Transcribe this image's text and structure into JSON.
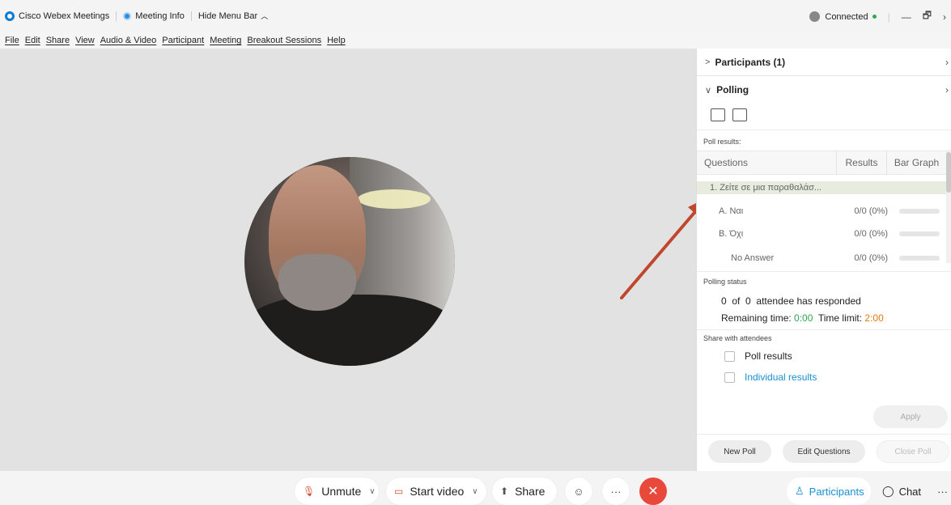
{
  "titlebar": {
    "app_name": "Cisco Webex Meetings",
    "meeting_info": "Meeting Info",
    "hide_menu": "Hide Menu Bar",
    "status": "Connected",
    "minimize": "—",
    "restore": "🗗",
    "close": "✕"
  },
  "menu": [
    "File",
    "Edit",
    "Share",
    "View",
    "Audio & Video",
    "Participant",
    "Meeting",
    "Breakout Sessions",
    "Help"
  ],
  "panel": {
    "participants_header": "Participants (1)",
    "polling_header": "Polling",
    "poll_results_label": "Poll results:",
    "columns": {
      "questions": "Questions",
      "results": "Results",
      "bar_graph": "Bar Graph"
    },
    "question": "1. Ζείτε σε μια παραθαλάσ...",
    "answers": [
      {
        "label": "A.  Ναι",
        "value": "0/0 (0%)"
      },
      {
        "label": "B.  Όχι",
        "value": "0/0 (0%)"
      },
      {
        "label": "No Answer",
        "value": "0/0 (0%)"
      }
    ],
    "polling_status_label": "Polling status",
    "responded_count": "0",
    "responded_total": "0",
    "responded_text": "attendee has responded",
    "of_text": "of",
    "remaining_label": "Remaining time:",
    "remaining_value": "0:00",
    "limit_label": "Time limit:",
    "limit_value": "2:00",
    "share_label": "Share with attendees",
    "share_poll_results": "Poll results",
    "share_individual": "Individual results",
    "apply": "Apply",
    "new_poll": "New Poll",
    "edit_questions": "Edit Questions",
    "close_poll": "Close Poll"
  },
  "controls": {
    "unmute": "Unmute",
    "start_video": "Start video",
    "share": "Share",
    "more": "···",
    "end": "✕",
    "participants": "Participants",
    "chat": "Chat",
    "overflow": "···"
  },
  "colors": {
    "accent": "#1a8fd1",
    "end_call": "#e8493a",
    "arrow": "#c0472e",
    "green": "#2fa84f",
    "orange": "#e07d10"
  }
}
